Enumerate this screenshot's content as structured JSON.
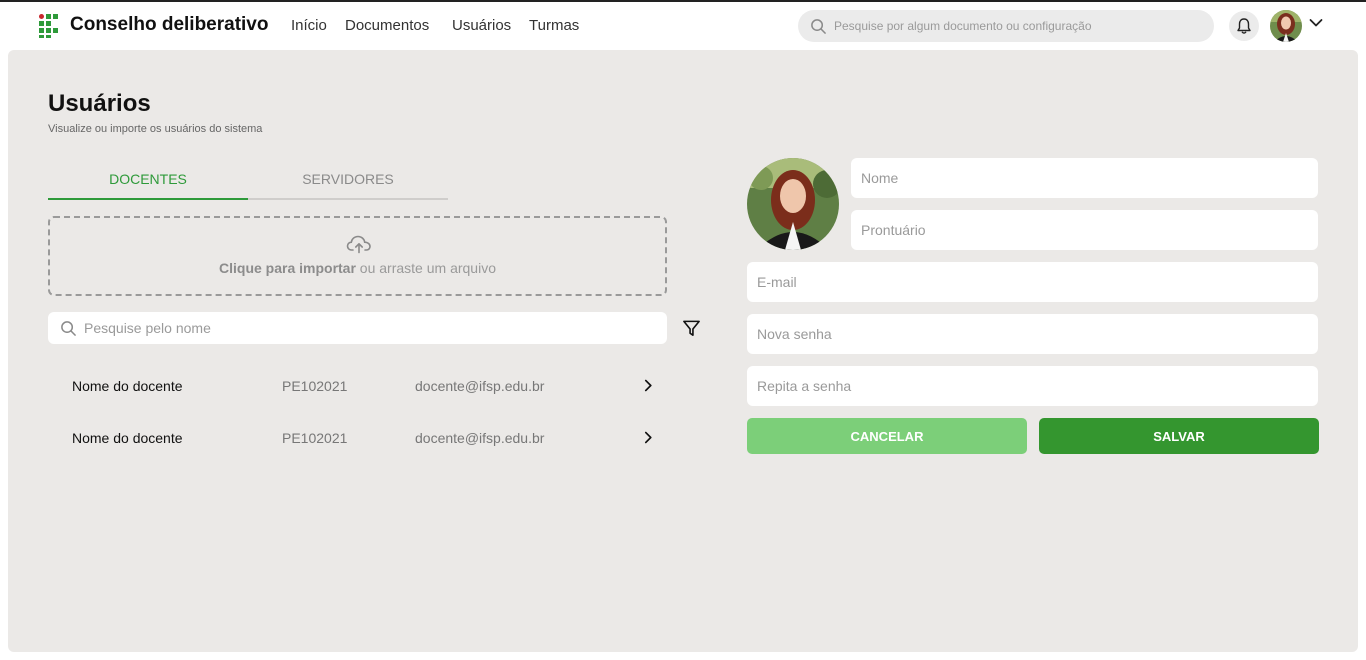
{
  "header": {
    "app_title": "Conselho deliberativo",
    "nav": [
      {
        "label": "Início"
      },
      {
        "label": "Documentos"
      },
      {
        "label": "Usuários"
      },
      {
        "label": "Turmas"
      }
    ],
    "search_placeholder": "Pesquise por algum documento ou configuração"
  },
  "page": {
    "title": "Usuários",
    "subtitle": "Visualize ou importe os usuários do sistema"
  },
  "tabs": [
    {
      "label": "DOCENTES",
      "active": true
    },
    {
      "label": "SERVIDORES",
      "active": false
    }
  ],
  "upload": {
    "bold_text": "Clique para importar",
    "rest_text": " ou arraste um arquivo"
  },
  "list": {
    "search_placeholder": "Pesquise pelo nome",
    "rows": [
      {
        "name": "Nome do docente",
        "prontuario": "PE102021",
        "email": "docente@ifsp.edu.br"
      },
      {
        "name": "Nome do docente",
        "prontuario": "PE102021",
        "email": "docente@ifsp.edu.br"
      }
    ]
  },
  "form": {
    "nome_placeholder": "Nome",
    "prontuario_placeholder": "Prontuário",
    "email_placeholder": "E-mail",
    "senha_placeholder": "Nova senha",
    "repita_placeholder": "Repita a senha",
    "cancel_label": "CANCELAR",
    "save_label": "SALVAR"
  },
  "colors": {
    "accent": "#2e9a3a",
    "save_button": "#34962f",
    "cancel_button": "#7ccf79",
    "panel_background": "#ebe9e7"
  }
}
